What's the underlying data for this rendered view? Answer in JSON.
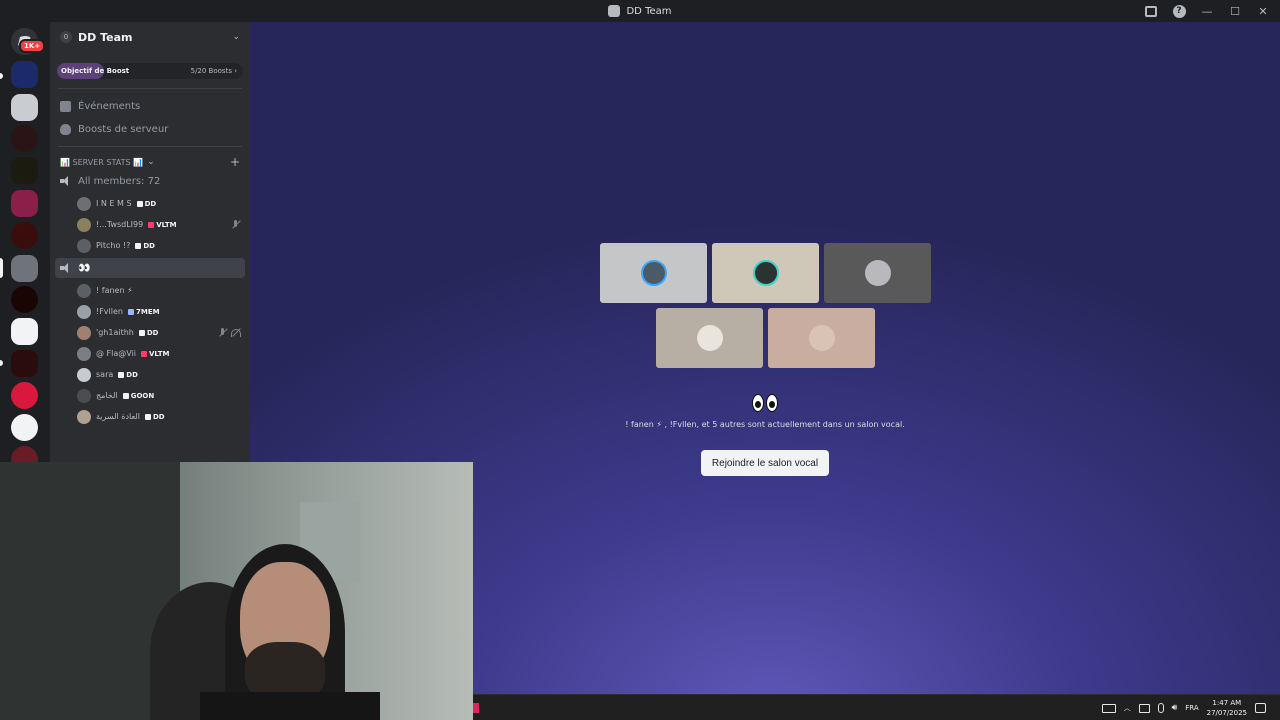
{
  "window": {
    "title": "DD Team"
  },
  "rail": {
    "badge": "1K+"
  },
  "server": {
    "tag": "0",
    "name": "DD Team",
    "boost": {
      "label": "Objectif de Boost",
      "count": "5/20 Boosts",
      "progress": 0.25
    }
  },
  "nav": [
    {
      "label": "Événements"
    },
    {
      "label": "Boosts de serveur"
    }
  ],
  "category": {
    "label": "📊 SERVER STATS 📊"
  },
  "channels": {
    "all_members": "All members: 72",
    "voice": "👀"
  },
  "members_top": [
    {
      "name": "I N E M S",
      "tag": "DD",
      "tag_color": "#f2f3f5"
    },
    {
      "name": "!...TwsdLI99",
      "tag": "VLTM",
      "tag_color": "#ff3b6b"
    },
    {
      "name": "Pitcho !?",
      "tag": "DD",
      "tag_color": "#f2f3f5"
    }
  ],
  "members_voice": [
    {
      "name": "! fanen ⚡",
      "tag": "",
      "tag_color": "#f2f3f5"
    },
    {
      "name": "!Fvllen",
      "tag": "7MEM",
      "tag_color": "#9ab4ff"
    },
    {
      "name": "'gh1aithh",
      "tag": "DD",
      "tag_color": "#f2f3f5"
    },
    {
      "name": "@ Fla@Vii",
      "tag": "VLTM",
      "tag_color": "#ff3b6b"
    },
    {
      "name": "sara",
      "tag": "DD",
      "tag_color": "#f2f3f5"
    },
    {
      "name": "الخامج",
      "tag": "GOON",
      "tag_color": "#f2f3f5"
    },
    {
      "name": "العادة السرية",
      "tag": "DD",
      "tag_color": "#f2f3f5"
    }
  ],
  "main": {
    "emoji_title": "👀",
    "description": "! fanen ⚡ , !Fvllen, et 5 autres sont actuellement dans un salon vocal.",
    "join_button": "Rejoindre le salon vocal"
  },
  "taskbar": {
    "language": "FRA",
    "time": "1:47 AM",
    "date": "27/07/2025"
  },
  "colors": {
    "accent_purple": "#5d3f7a",
    "bg_gradient_center": "#5e59b8",
    "bg_gradient_edge": "#27265a"
  }
}
